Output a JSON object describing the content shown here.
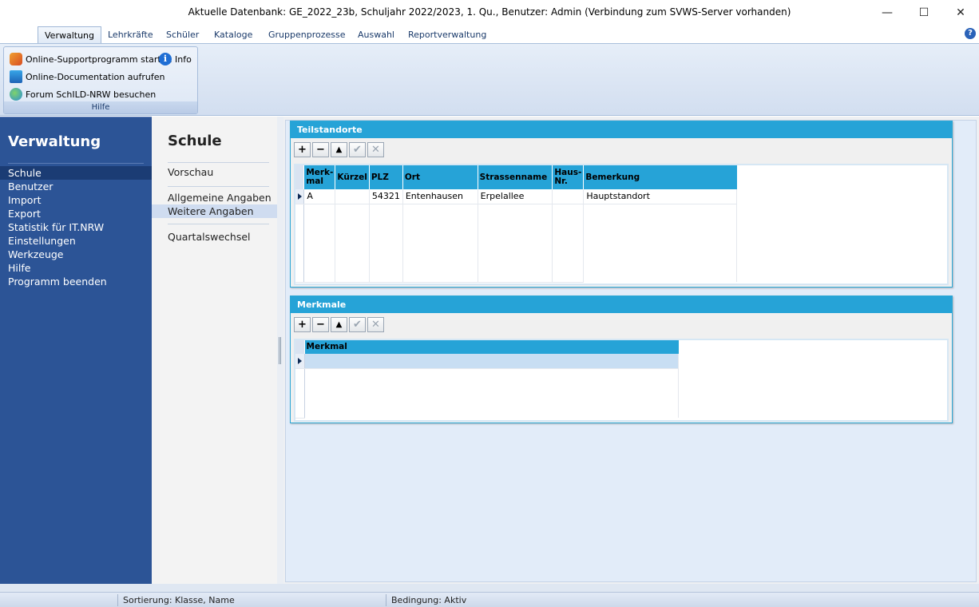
{
  "window": {
    "title": "Aktuelle Datenbank: GE_2022_23b, Schuljahr 2022/2023, 1. Qu., Benutzer: Admin (Verbindung zum SVWS-Server vorhanden)",
    "minimize": "—",
    "maximize": "☐",
    "close": "✕"
  },
  "ribbon": {
    "tabs": [
      "Verwaltung",
      "Lehrkräfte",
      "Schüler",
      "Kataloge",
      "Gruppenprozesse",
      "Auswahl",
      "Reportverwaltung"
    ],
    "active_tab": "Verwaltung",
    "help_glyph": "?",
    "group": {
      "label": "Hilfe",
      "buttons": {
        "support": "Online-Supportprogramm starten",
        "info": "Info",
        "info_glyph": "i",
        "documentation": "Online-Documentation aufrufen",
        "forum": "Forum SchILD-NRW besuchen"
      }
    }
  },
  "nav": {
    "title": "Verwaltung",
    "items": [
      "Schule",
      "Benutzer",
      "Import",
      "Export",
      "Statistik für IT.NRW",
      "Einstellungen",
      "Werkzeuge",
      "Hilfe",
      "Programm beenden"
    ],
    "selected": "Schule"
  },
  "subnav": {
    "title": "Schule",
    "items": [
      "Vorschau",
      "Allgemeine Angaben",
      "Weitere Angaben",
      "Quartalswechsel"
    ],
    "selected": "Weitere Angaben"
  },
  "toolbar_glyphs": {
    "add": "+",
    "remove": "−",
    "up": "▲",
    "confirm": "✔",
    "cancel": "✕"
  },
  "teilstandorte": {
    "title": "Teilstandorte",
    "columns": [
      "Merk-\nmal",
      "Kürzel",
      "PLZ",
      "Ort",
      "Strassenname",
      "Haus-\nNr.",
      "Bemerkung"
    ],
    "rows": [
      {
        "merkmal": "A",
        "kuerzel": "",
        "plz": "54321",
        "ort": "Entenhausen",
        "strasse": "Erpelallee",
        "hausnr": "",
        "bemerkung": "Hauptstandort"
      }
    ]
  },
  "merkmale": {
    "title": "Merkmale",
    "columns": [
      "Merkmal"
    ],
    "rows": [
      {
        "merkmal": ""
      }
    ]
  },
  "status": {
    "sortierung": "Sortierung: Klasse, Name",
    "bedingung": "Bedingung: Aktiv"
  }
}
